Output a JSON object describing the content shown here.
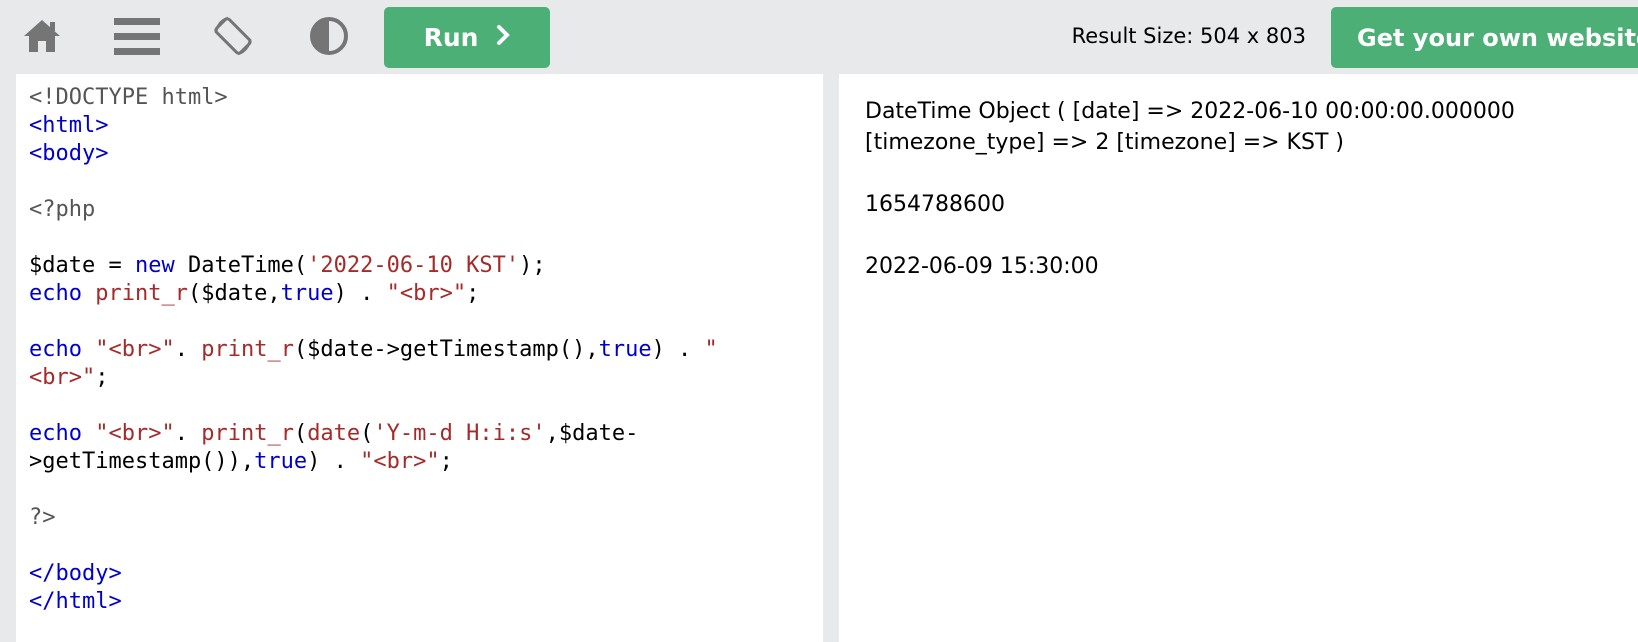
{
  "toolbar": {
    "icons": [
      "home-icon",
      "menu-icon",
      "rotate-icon",
      "contrast-icon"
    ],
    "run_label": "Run",
    "run_icon": "chevron-right-icon",
    "result_size_label": "Result Size: 504 x 803",
    "get_website_label": "Get your own website"
  },
  "colors": {
    "toolbar_bg": "#e7e9eb",
    "button_green": "#4caf76",
    "code_tag_blue": "#0000cd",
    "code_string_red": "#a52a2a"
  },
  "code": {
    "lines": [
      "<!DOCTYPE html>",
      "<html>",
      "<body>",
      "",
      "<?php",
      "",
      "$date = new DateTime('2022-06-10 KST');",
      "echo print_r($date,true) . \"<br>\";",
      "",
      "echo \"<br>\". print_r($date->getTimestamp(),true) . \"",
      "<br>\";",
      "",
      "echo \"<br>\". print_r(date('Y-m-d H:i:s',$date-",
      ">getTimestamp()),true) . \"<br>\";",
      "",
      "?>",
      "",
      "</body>",
      "</html>"
    ]
  },
  "result": {
    "output_lines": [
      "DateTime Object ( [date] => 2022-06-10 00:00:00.000000 [timezone_type] => 2 [timezone] => KST )",
      "1654788600",
      "2022-06-09 15:30:00"
    ]
  }
}
